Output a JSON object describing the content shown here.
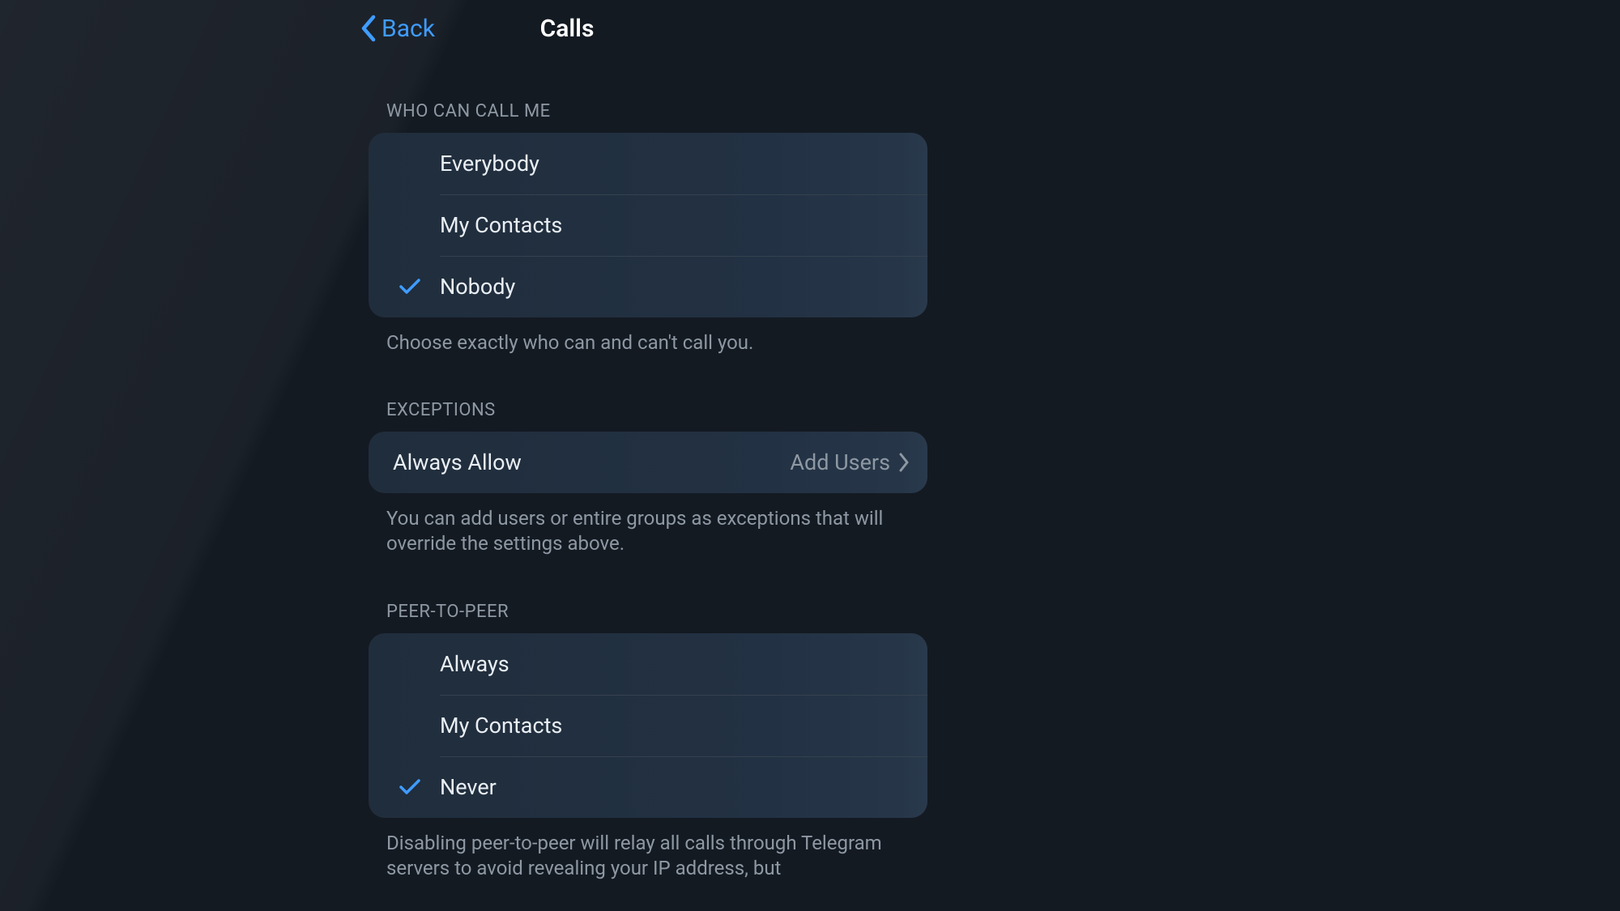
{
  "nav": {
    "back_label": "Back",
    "title": "Calls"
  },
  "sections": {
    "who_can_call": {
      "header": "WHO CAN CALL ME",
      "options": [
        {
          "label": "Everybody",
          "selected": false
        },
        {
          "label": "My Contacts",
          "selected": false
        },
        {
          "label": "Nobody",
          "selected": true
        }
      ],
      "footer": "Choose exactly who can and can't call you."
    },
    "exceptions": {
      "header": "EXCEPTIONS",
      "row_label": "Always Allow",
      "row_value": "Add Users",
      "footer": "You can add users or entire groups as exceptions that will override the settings above."
    },
    "peer_to_peer": {
      "header": "PEER-TO-PEER",
      "options": [
        {
          "label": "Always",
          "selected": false
        },
        {
          "label": "My Contacts",
          "selected": false
        },
        {
          "label": "Never",
          "selected": true
        }
      ],
      "footer": "Disabling peer-to-peer will relay all calls through Telegram servers to avoid revealing your IP address, but"
    }
  },
  "colors": {
    "accent": "#3f9cff"
  }
}
